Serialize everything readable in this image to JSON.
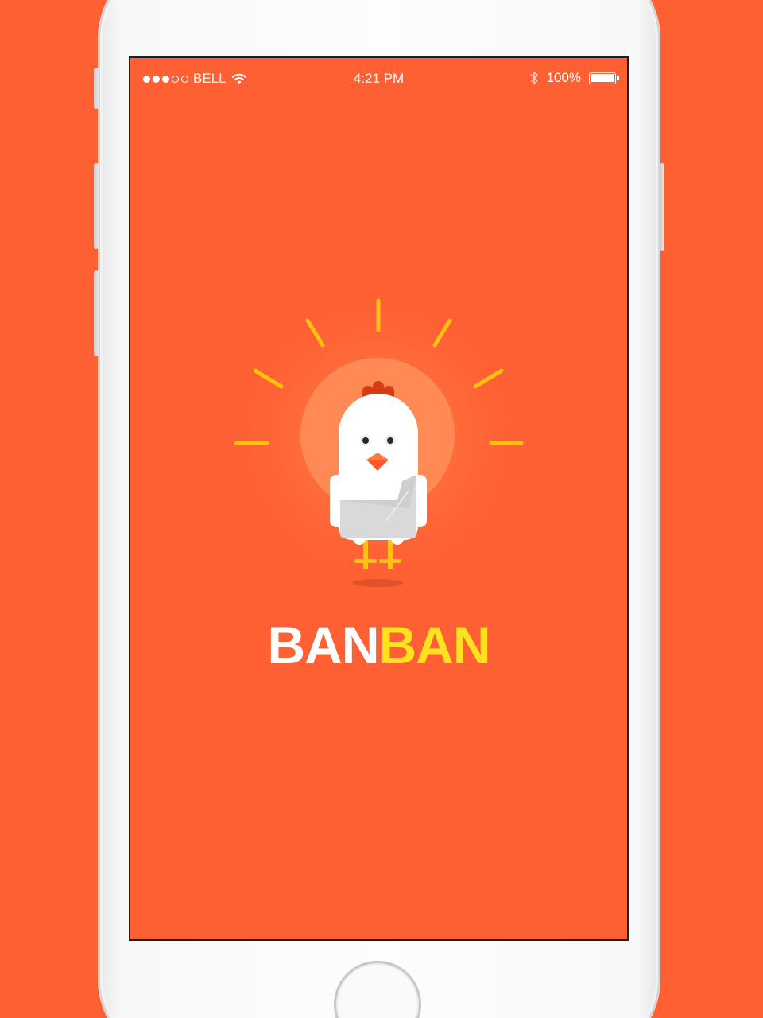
{
  "status_bar": {
    "carrier": "BELL",
    "time": "4:21 PM",
    "battery_percent": "100%",
    "signal_bars_filled": 3,
    "signal_bars_total": 5
  },
  "app": {
    "logo_part1": "BAN",
    "logo_part2": "BAN"
  },
  "colors": {
    "background": "#ff6033",
    "logo_white": "#ffffff",
    "logo_yellow": "#ffe11f",
    "sun_rays": "#ffc20e",
    "comb": "#d93a16"
  },
  "icons": {
    "wifi": "wifi-icon",
    "bluetooth": "bluetooth-icon",
    "battery": "battery-icon",
    "mascot": "chicken-mascot"
  }
}
